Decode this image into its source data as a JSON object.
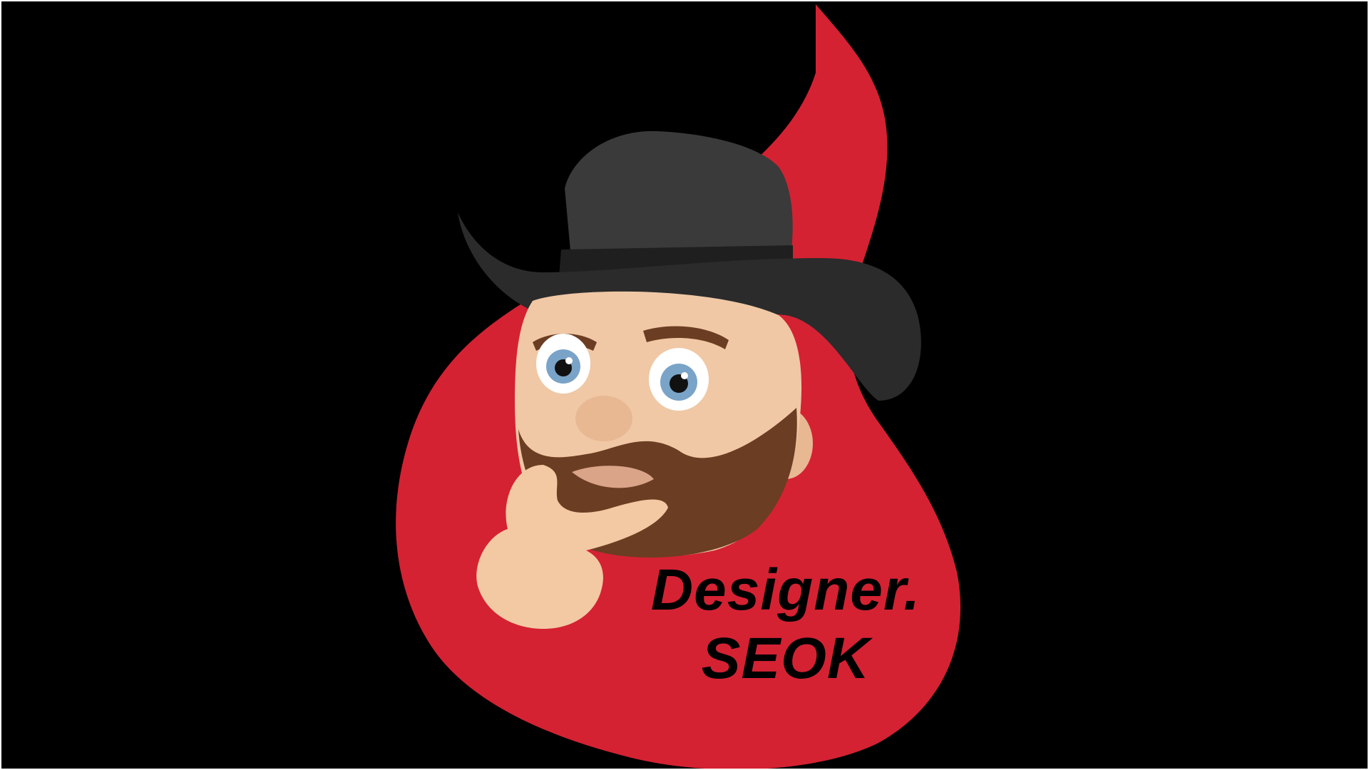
{
  "brand": {
    "line1": "Designer.",
    "line2": "SEOK"
  },
  "colors": {
    "background": "#000000",
    "flame": "#d42233",
    "hat": "#2b2b2b",
    "skin": "#f0c8a5",
    "beard": "#6b3d22",
    "eye_iris": "#7aa3c8"
  },
  "illustration": {
    "icon": "cowboy-memoji-thinking-icon"
  }
}
